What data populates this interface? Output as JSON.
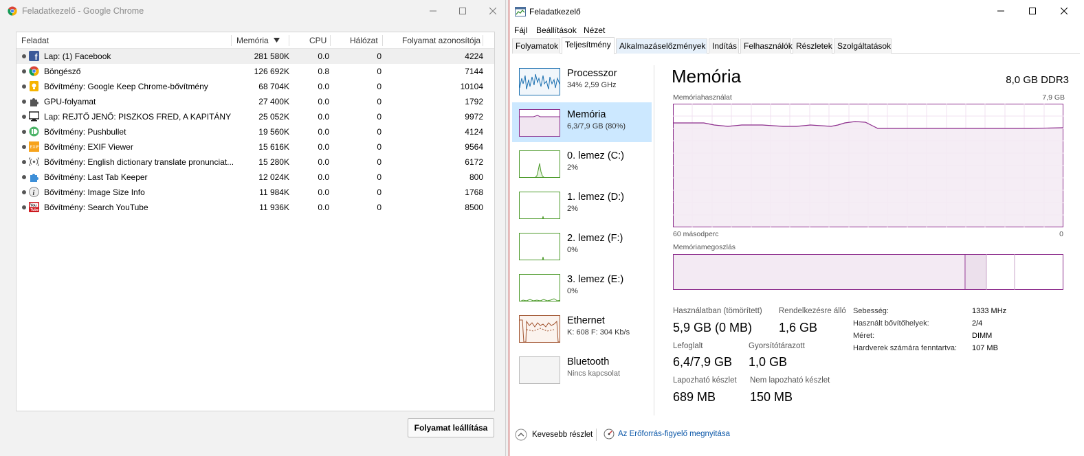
{
  "chrome": {
    "title": "Feladatkezelő - Google Chrome",
    "columns": {
      "task": "Feladat",
      "memory": "Memória",
      "cpu": "CPU",
      "network": "Hálózat",
      "pid": "Folyamat azonosítója"
    },
    "rows": [
      {
        "name": "Lap: (1) Facebook",
        "memory": "281 580K",
        "cpu": "0.0",
        "network": "0",
        "pid": "4224",
        "icon": "facebook-icon"
      },
      {
        "name": "Böngésző",
        "memory": "126 692K",
        "cpu": "0.8",
        "network": "0",
        "pid": "7144",
        "icon": "chrome-icon"
      },
      {
        "name": "Bővítmény: Google Keep Chrome-bővítmény",
        "memory": "68 704K",
        "cpu": "0.0",
        "network": "0",
        "pid": "10104",
        "icon": "keep-icon"
      },
      {
        "name": "GPU-folyamat",
        "memory": "27 400K",
        "cpu": "0.0",
        "network": "0",
        "pid": "1792",
        "icon": "puzzle-icon"
      },
      {
        "name": "Lap: REJTŐ JENŐ: PISZKOS FRED, A KAPITÁNY",
        "memory": "25 052K",
        "cpu": "0.0",
        "network": "0",
        "pid": "9972",
        "icon": "monitor-icon"
      },
      {
        "name": "Bővítmény: Pushbullet",
        "memory": "19 560K",
        "cpu": "0.0",
        "network": "0",
        "pid": "4124",
        "icon": "pushbullet-icon"
      },
      {
        "name": "Bővítmény: EXIF Viewer",
        "memory": "15 616K",
        "cpu": "0.0",
        "network": "0",
        "pid": "9564",
        "icon": "exif-icon"
      },
      {
        "name": "Bővítmény: English dictionary translate pronunciat...",
        "memory": "15 280K",
        "cpu": "0.0",
        "network": "0",
        "pid": "6172",
        "icon": "audio-icon"
      },
      {
        "name": "Bővítmény: Last Tab Keeper",
        "memory": "12 024K",
        "cpu": "0.0",
        "network": "0",
        "pid": "800",
        "icon": "puzzle-blue-icon"
      },
      {
        "name": "Bővítmény: Image Size Info",
        "memory": "11 984K",
        "cpu": "0.0",
        "network": "0",
        "pid": "1768",
        "icon": "info-icon"
      },
      {
        "name": "Bővítmény: Search YouTube",
        "memory": "11 936K",
        "cpu": "0.0",
        "network": "0",
        "pid": "8500",
        "icon": "youtube-icon"
      }
    ],
    "stop_button": "Folyamat leállítása"
  },
  "tm": {
    "title": "Feladatkezelő",
    "menu": [
      "Fájl",
      "Beállítások",
      "Nézet"
    ],
    "tabs": [
      "Folyamatok",
      "Teljesítmény",
      "Alkalmazáselőzmények",
      "Indítás",
      "Felhasználók",
      "Részletek",
      "Szolgáltatások"
    ],
    "side": [
      {
        "name": "Processzor",
        "sub": "34%  2,59 GHz"
      },
      {
        "name": "Memória",
        "sub": "6,3/7,9 GB (80%)"
      },
      {
        "name": "0. lemez (C:)",
        "sub": "2%"
      },
      {
        "name": "1. lemez (D:)",
        "sub": "2%"
      },
      {
        "name": "2. lemez (F:)",
        "sub": "0%"
      },
      {
        "name": "3. lemez (E:)",
        "sub": "0%"
      },
      {
        "name": "Ethernet",
        "sub": "K: 608  F: 304 Kb/s"
      },
      {
        "name": "Bluetooth",
        "sub": "Nincs kapcsolat"
      }
    ],
    "main": {
      "title": "Memória",
      "spec": "8,0 GB DDR3",
      "usage_label": "Memóriahasználat",
      "usage_max": "7,9 GB",
      "time_left": "60 másodperc",
      "time_right": "0",
      "composition_label": "Memóriamegoszlás",
      "stats": {
        "in_use_label": "Használatban (tömörített)",
        "in_use": "5,9 GB (0 MB)",
        "available_label": "Rendelkezésre álló",
        "available": "1,6 GB",
        "committed_label": "Lefoglalt",
        "committed": "6,4/7,9 GB",
        "cached_label": "Gyorsítótárazott",
        "cached": "1,0 GB",
        "paged_label": "Lapozható készlet",
        "paged": "689 MB",
        "nonpaged_label": "Nem lapozható készlet",
        "nonpaged": "150 MB"
      },
      "kv": [
        {
          "k": "Sebesség:",
          "v": "1333 MHz"
        },
        {
          "k": "Használt bővítőhelyek:",
          "v": "2/4"
        },
        {
          "k": "Méret:",
          "v": "DIMM"
        },
        {
          "k": "Hardverek számára fenntartva:",
          "v": "107 MB"
        }
      ]
    },
    "bottom": {
      "less": "Kevesebb részlet",
      "monitor": "Az Erőforrás-figyelő megnyitása"
    }
  }
}
